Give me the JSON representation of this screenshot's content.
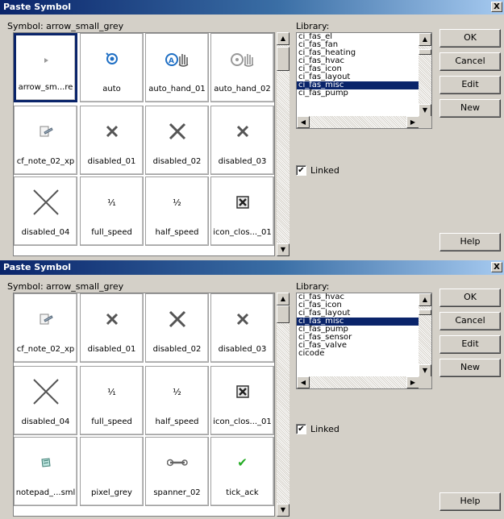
{
  "dialogs": [
    {
      "title": "Paste Symbol",
      "close_glyph": "X",
      "symbol_label": "Symbol:   arrow_small_grey",
      "tiles": [
        {
          "label": "arrow_sm...re",
          "icon": "small-arrow-icon",
          "selected": true
        },
        {
          "label": "auto",
          "icon": "auto-icon"
        },
        {
          "label": "auto_hand_01",
          "icon": "auto-hand-01-icon"
        },
        {
          "label": "auto_hand_02",
          "icon": "auto-hand-02-icon"
        },
        {
          "label": "cf_note_02_xp",
          "icon": "note-icon"
        },
        {
          "label": "disabled_01",
          "icon": "disabled-x-icon"
        },
        {
          "label": "disabled_02",
          "icon": "disabled-x-large-icon"
        },
        {
          "label": "disabled_03",
          "icon": "disabled-x-icon"
        },
        {
          "label": "disabled_04",
          "icon": "disabled-x-thin-icon"
        },
        {
          "label": "full_speed",
          "icon": "full-speed-icon"
        },
        {
          "label": "half_speed",
          "icon": "half-speed-icon"
        },
        {
          "label": "icon_clos..._01",
          "icon": "close-box-icon"
        }
      ],
      "library_label": "Library:",
      "library_items": [
        "ci_fas_el",
        "ci_fas_fan",
        "ci_fas_heating",
        "ci_fas_hvac",
        "ci_fas_icon",
        "ci_fas_layout",
        "ci_fas_misc",
        "ci_fas_pump"
      ],
      "library_selected": 6,
      "linked_label": "Linked",
      "linked_checked": true,
      "buttons": {
        "ok": "OK",
        "cancel": "Cancel",
        "edit": "Edit",
        "new": "New",
        "help": "Help"
      }
    },
    {
      "title": "Paste Symbol",
      "close_glyph": "X",
      "symbol_label": "Symbol:   arrow_small_grey",
      "tiles": [
        {
          "label": "cf_note_02_xp",
          "icon": "note-icon"
        },
        {
          "label": "disabled_01",
          "icon": "disabled-x-icon"
        },
        {
          "label": "disabled_02",
          "icon": "disabled-x-large-icon"
        },
        {
          "label": "disabled_03",
          "icon": "disabled-x-icon"
        },
        {
          "label": "disabled_04",
          "icon": "disabled-x-thin-icon"
        },
        {
          "label": "full_speed",
          "icon": "full-speed-icon"
        },
        {
          "label": "half_speed",
          "icon": "half-speed-icon"
        },
        {
          "label": "icon_clos..._01",
          "icon": "close-box-icon"
        },
        {
          "label": "notepad_...sml",
          "icon": "notepad-icon"
        },
        {
          "label": "pixel_grey",
          "icon": "pixel-icon"
        },
        {
          "label": "spanner_02",
          "icon": "spanner-icon"
        },
        {
          "label": "tick_ack",
          "icon": "tick-icon"
        }
      ],
      "library_label": "Library:",
      "library_items": [
        "ci_fas_hvac",
        "ci_fas_icon",
        "ci_fas_layout",
        "ci_fas_misc",
        "ci_fas_pump",
        "ci_fas_sensor",
        "ci_fas_valve",
        "cicode"
      ],
      "library_selected": 3,
      "linked_label": "Linked",
      "linked_checked": true,
      "buttons": {
        "ok": "OK",
        "cancel": "Cancel",
        "edit": "Edit",
        "new": "New",
        "help": "Help"
      }
    }
  ],
  "glyphs": {
    "check": "✔",
    "scroll_up": "▲",
    "scroll_down": "▼",
    "scroll_left": "◀",
    "scroll_right": "▶",
    "full_speed": "¹⁄₁",
    "half_speed": "¹⁄₂"
  },
  "colors": {
    "selection": "#0a246a",
    "tick": "#22aa22",
    "auto_blue": "#1f6fc4"
  }
}
